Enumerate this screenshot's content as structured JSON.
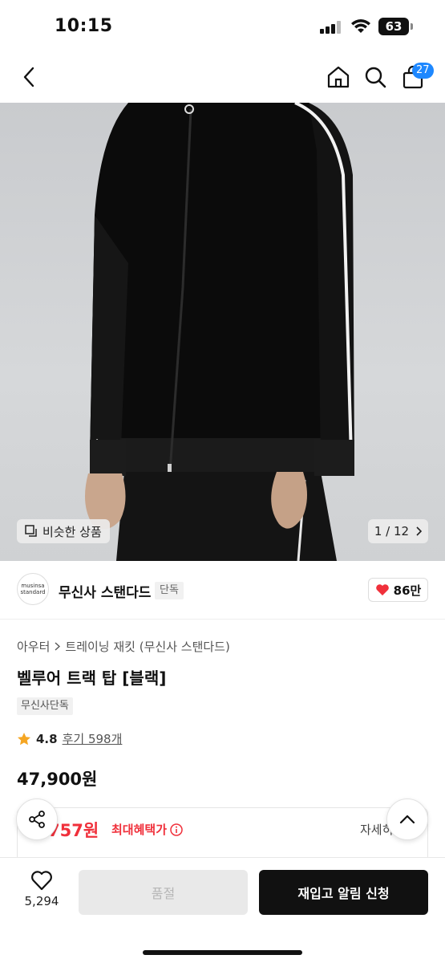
{
  "status_bar": {
    "time": "10:15",
    "battery": "63"
  },
  "nav": {
    "cart_count": "27"
  },
  "gallery": {
    "similar_label": "비슷한 상품",
    "pager": "1 / 12"
  },
  "brand": {
    "logo_line1": "musinsa",
    "logo_line2": "standard",
    "name": "무신사 스탠다드",
    "tag": "단독",
    "likes": "86만"
  },
  "product": {
    "breadcrumb": [
      "아우터",
      "트레이닝 재킷 (무신사 스탠다드)"
    ],
    "title": "벨루어 트랙 탑 [블랙]",
    "exclusive_tag": "무신사단독",
    "rating": "4.8",
    "reviews": "후기 598개",
    "price": "47,900원"
  },
  "benefit": {
    "price": ",757원",
    "label": "최대혜택가",
    "detail": "자세히"
  },
  "bottom_bar": {
    "wish_count": "5,294",
    "soldout_label": "품절",
    "restock_label": "재입고 알림 신청"
  },
  "colors": {
    "accent_red": "#f0303b",
    "badge_blue": "#1e88ff",
    "primary_black": "#111111"
  }
}
